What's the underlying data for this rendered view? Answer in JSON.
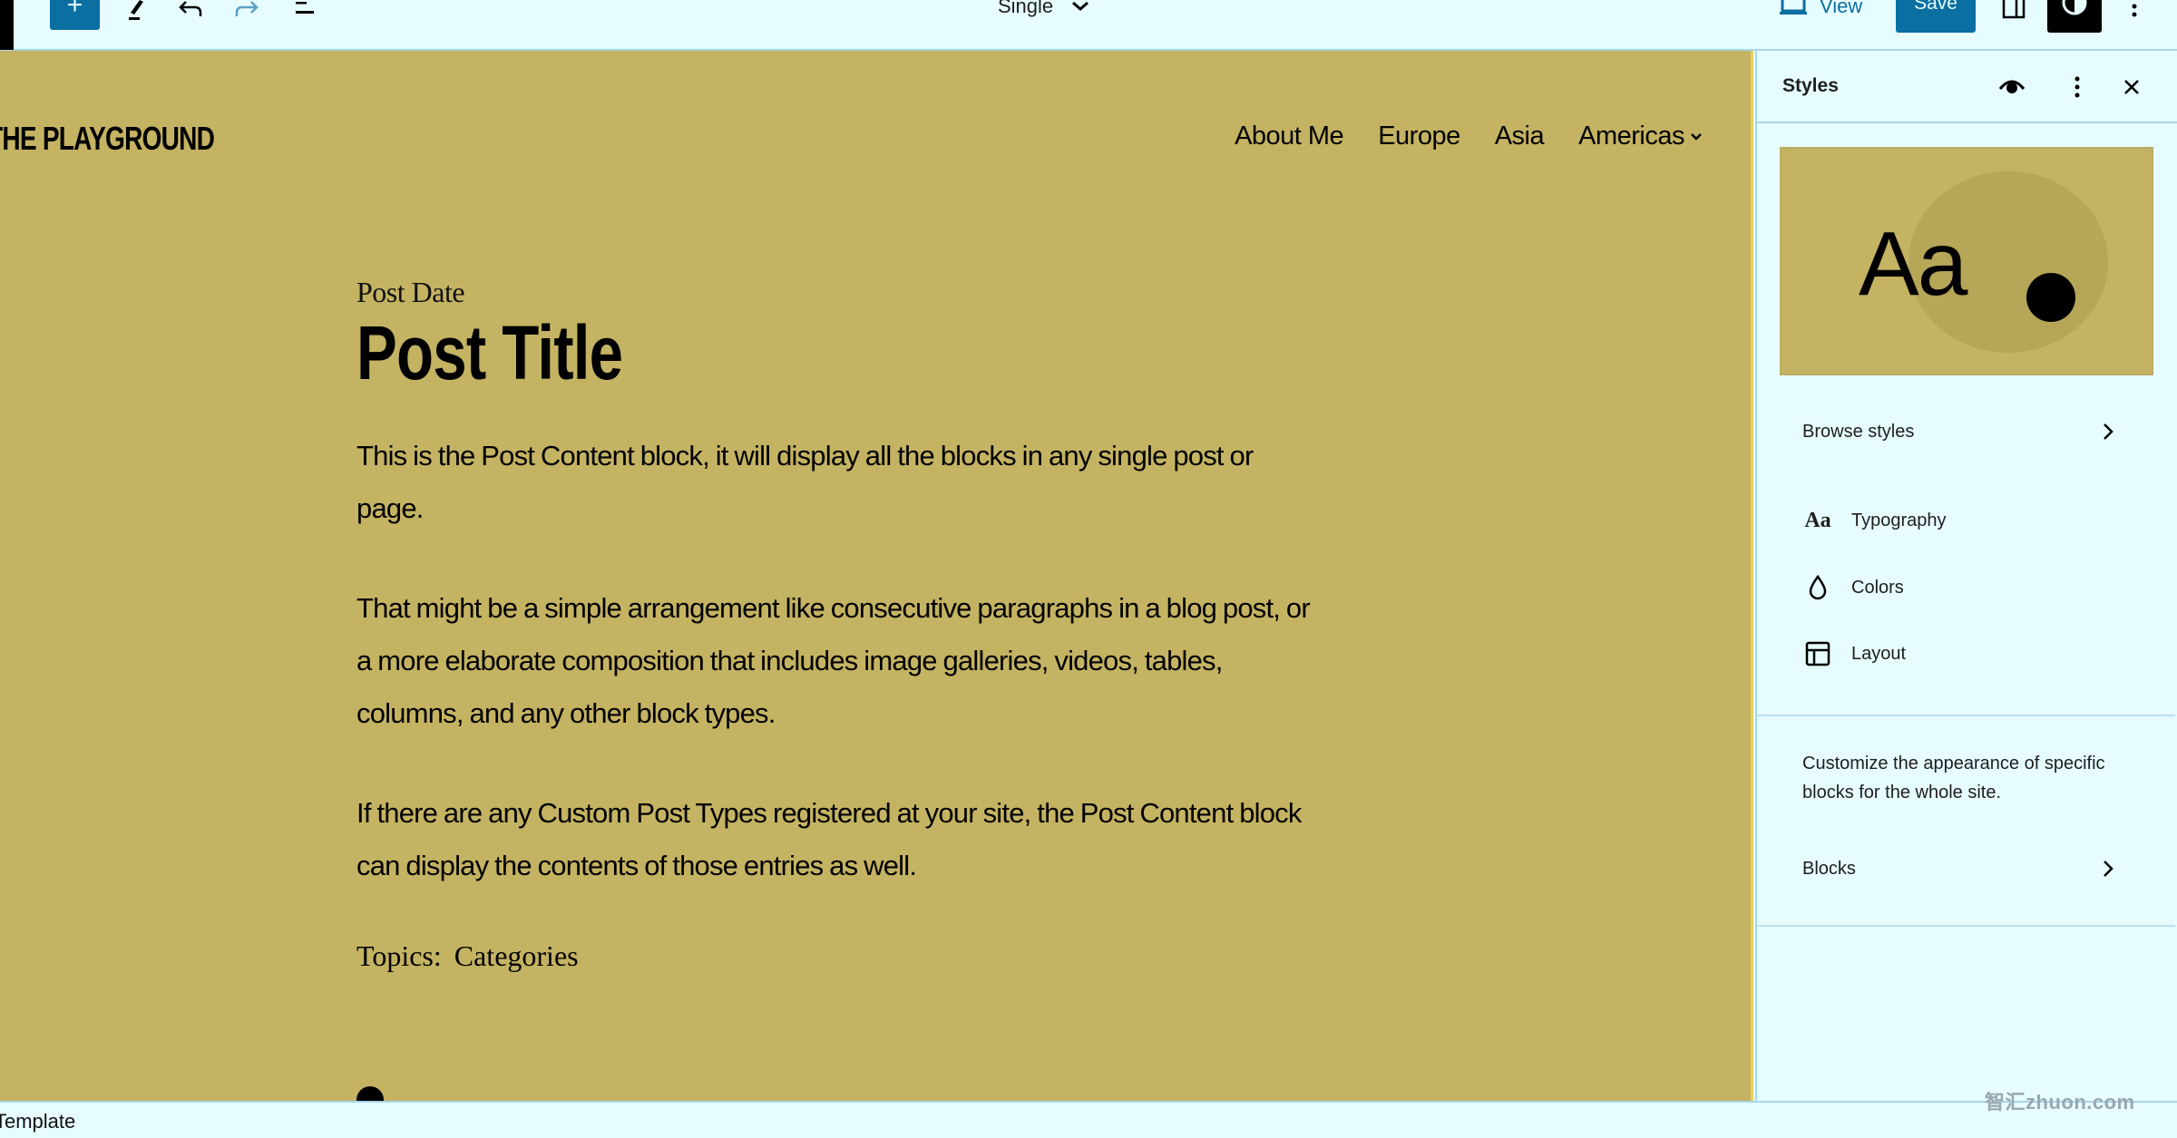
{
  "topbar": {
    "add_label": "+",
    "template_name": "Single",
    "view_label": "View",
    "save_label": "Save"
  },
  "canvas": {
    "site_title": "THE PLAYGROUND",
    "nav": [
      {
        "label": "About Me"
      },
      {
        "label": "Europe"
      },
      {
        "label": "Asia"
      },
      {
        "label": "Americas",
        "has_submenu": true
      }
    ],
    "post_date": "Post Date",
    "post_title": "Post Title",
    "paragraphs": [
      "This is the Post Content block, it will display all the blocks in any single post or page.",
      "That might be a simple arrangement like consecutive paragraphs in a blog post, or a more elaborate composition that includes image galleries, videos, tables, columns, and any other block types.",
      "If there are any Custom Post Types registered at your site, the Post Content block can display the contents of those entries as well."
    ],
    "topics_label": "Topics:",
    "topics_value": "Categories",
    "background_color": "#c4b362"
  },
  "sidebar": {
    "title": "Styles",
    "preview_text": "Aa",
    "browse_styles": "Browse styles",
    "items": [
      {
        "label": "Typography",
        "icon": "typography-icon",
        "glyph": "Aa"
      },
      {
        "label": "Colors",
        "icon": "droplet-icon"
      },
      {
        "label": "Layout",
        "icon": "layout-icon"
      }
    ],
    "blocks_description": "Customize the appearance of specific blocks for the whole site.",
    "blocks_label": "Blocks"
  },
  "statusbar": {
    "text": "Template"
  },
  "watermark": "智汇zhuon.com",
  "colors": {
    "accent": "#0b6fa2",
    "chrome_bg": "#e6fcff",
    "canvas_bg": "#c4b362"
  }
}
